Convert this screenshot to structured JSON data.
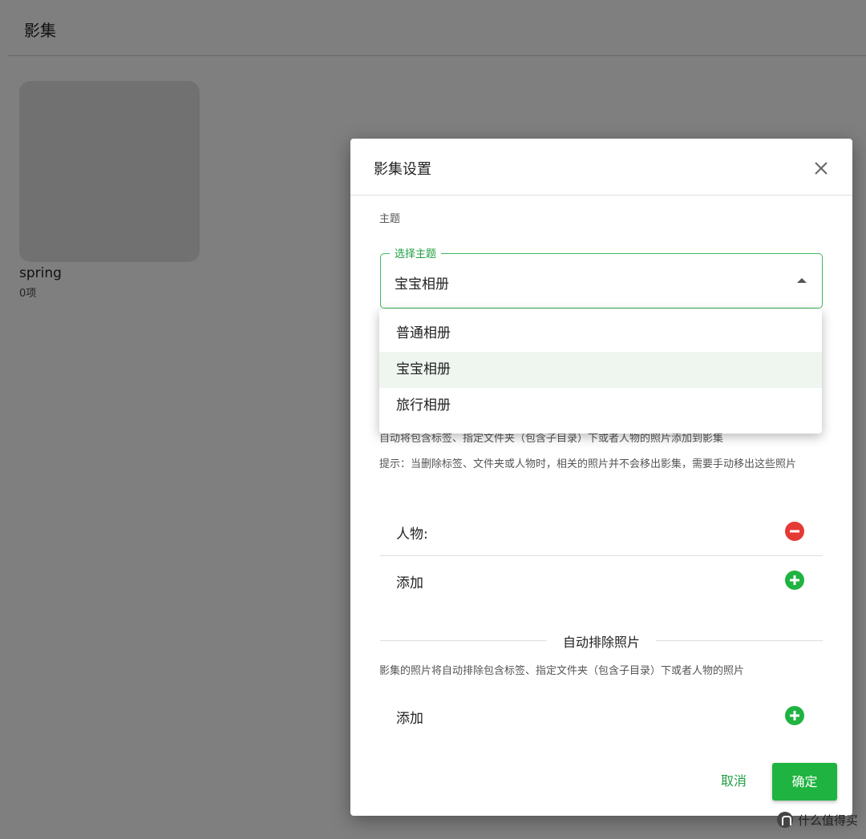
{
  "page": {
    "title": "影集",
    "album": {
      "name": "spring",
      "count": "0项"
    }
  },
  "dialog": {
    "title": "影集设置",
    "theme_label": "主题",
    "select": {
      "legend": "选择主题",
      "value": "宝宝相册"
    },
    "dropdown_options": [
      "普通相册",
      "宝宝相册",
      "旅行相册"
    ],
    "selected_index": 1,
    "auto_add_desc": "自动将包含标签、指定文件夹（包含子目录）下或者人物的照片添加到影集",
    "hint": "提示：当删除标签、文件夹或人物时，相关的照片并不会移出影集，需要手动移出这些照片",
    "person_label": "人物:",
    "add_label": "添加",
    "exclude_section_title": "自动排除照片",
    "exclude_desc": "影集的照片将自动排除包含标签、指定文件夹（包含子目录）下或者人物的照片",
    "exclude_add_label": "添加",
    "cancel": "取消",
    "confirm": "确定"
  },
  "watermark": {
    "text": "什么值得买"
  },
  "colors": {
    "accent": "#1fb341",
    "remove": "#e53935",
    "selected_bg": "#eef6ef"
  },
  "icons": {
    "close": "close-icon",
    "remove": "minus-circle-icon",
    "add": "plus-circle-icon",
    "caret": "caret-up-icon"
  }
}
